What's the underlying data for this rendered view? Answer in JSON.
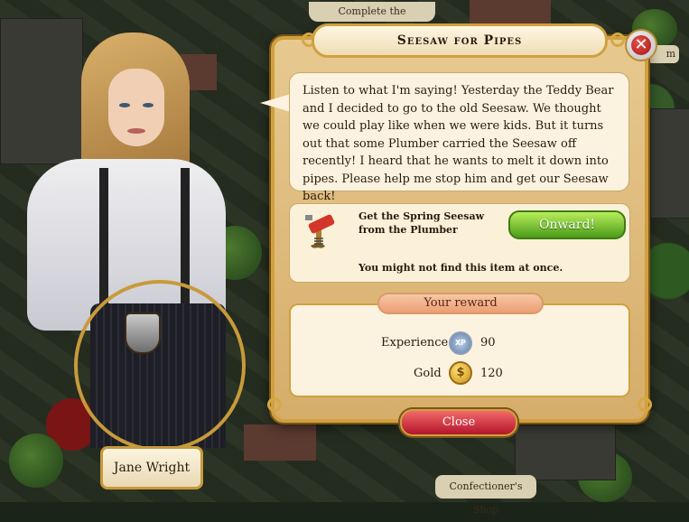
{
  "hud": {
    "top_objective": "Complete the investigation",
    "edge_tab": "m",
    "bottom_location": "Confectioner's Shop"
  },
  "character": {
    "name": "Jane Wright"
  },
  "dialog": {
    "title": "Seesaw for Pipes",
    "speech": "Listen to what I'm saying! Yesterday the Teddy Bear and I decided to go to the old Seesaw. We thought we could play like when we were kids. But it turns out that some Plumber carried the Seesaw off recently! I heard that he wants to melt it down into pipes. Please help me stop him and get our Seesaw back!",
    "quest": {
      "task": "Get the Spring Seesaw from the Plumber",
      "note": "You might not find this item at once.",
      "button": "Onward!",
      "item_icon": "spring-seesaw-icon"
    },
    "reward": {
      "title": "Your reward",
      "experience_label": "Experience",
      "experience_icon_text": "XP",
      "experience_value": "90",
      "gold_label": "Gold",
      "gold_value": "120"
    },
    "close_button": "Close"
  },
  "colors": {
    "panel_border": "#d0a03e",
    "panel_fill": "#e7c990",
    "onward_green": "#4b9c1a",
    "close_red": "#b3142a"
  }
}
